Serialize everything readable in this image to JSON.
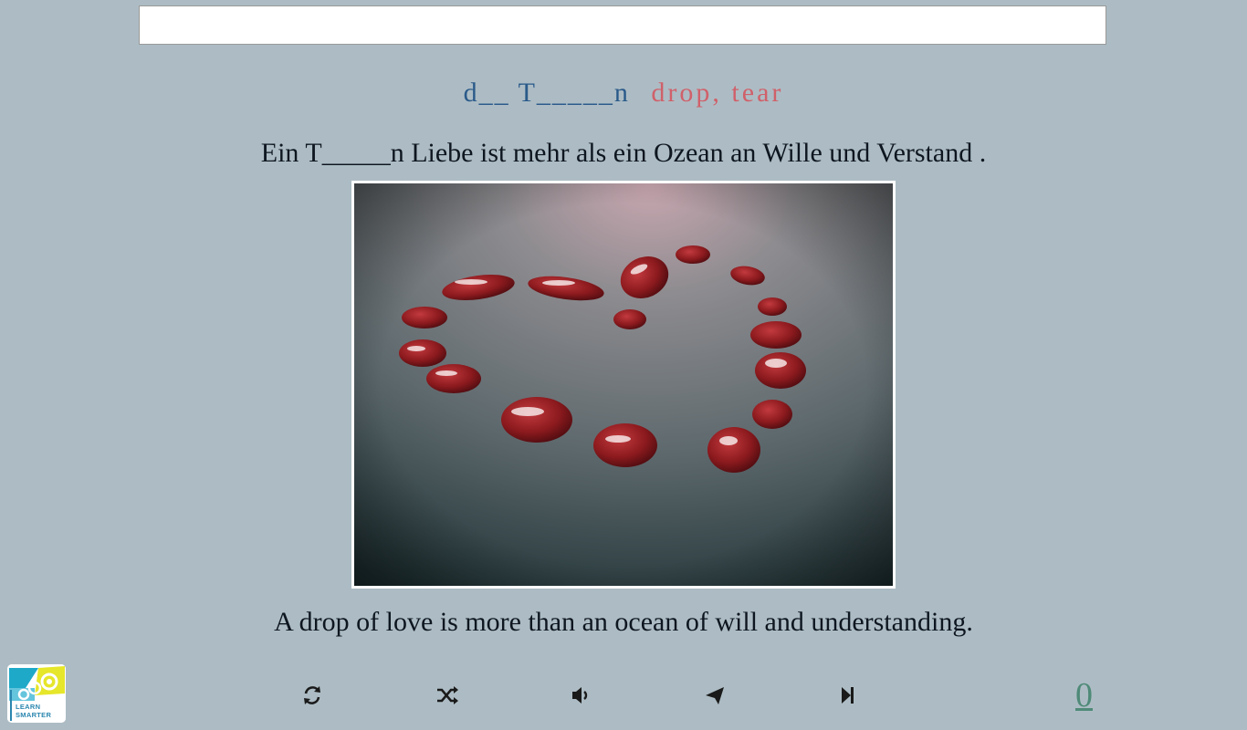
{
  "input": {
    "value": "",
    "placeholder": ""
  },
  "word": {
    "hint": "d__ T_____n",
    "translation": "drop, tear"
  },
  "sentence": {
    "german": "Ein T_____n Liebe ist mehr als ein Ozean an Wille und Verstand .",
    "english": "A drop of love is more than an ocean of will and understanding."
  },
  "image": {
    "subject": "red drops in a heart shape"
  },
  "logo": {
    "line1": "LEARN",
    "line2": "SMARTER"
  },
  "toolbar": {
    "buttons": [
      {
        "icon": "refresh-icon"
      },
      {
        "icon": "shuffle-icon"
      },
      {
        "icon": "volume-icon"
      },
      {
        "icon": "send-icon"
      },
      {
        "icon": "skip-next-icon"
      }
    ]
  },
  "score": "0",
  "colors": {
    "background": "#adbcc4",
    "hint": "#2a5a8a",
    "translation": "#d0606a",
    "score": "#4f8a78"
  }
}
